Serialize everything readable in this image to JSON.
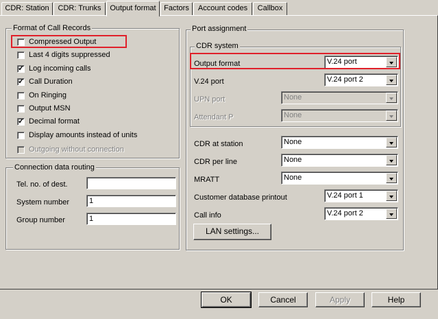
{
  "tabs": [
    {
      "label": "CDR: Station",
      "active": false
    },
    {
      "label": "CDR: Trunks",
      "active": false
    },
    {
      "label": "Output format",
      "active": true
    },
    {
      "label": "Factors",
      "active": false
    },
    {
      "label": "Account codes",
      "active": false
    },
    {
      "label": "Callbox",
      "active": false
    }
  ],
  "format_group": {
    "title": "Format of Call Records",
    "items": [
      {
        "label": "Compressed Output",
        "checked": false,
        "enabled": true
      },
      {
        "label": "Last 4 digits suppressed",
        "checked": false,
        "enabled": true
      },
      {
        "label": "Log incoming calls",
        "checked": true,
        "enabled": true
      },
      {
        "label": "Call Duration",
        "checked": true,
        "enabled": true
      },
      {
        "label": "On Ringing",
        "checked": false,
        "enabled": true
      },
      {
        "label": "Output MSN",
        "checked": false,
        "enabled": true
      },
      {
        "label": "Decimal format",
        "checked": true,
        "enabled": true
      },
      {
        "label": "Display amounts instead of units",
        "checked": false,
        "enabled": true
      },
      {
        "label": "Outgoing without connection",
        "checked": false,
        "enabled": false
      }
    ]
  },
  "routing_group": {
    "title": "Connection data routing",
    "tel_label": "Tel. no. of dest.",
    "tel_value": "",
    "system_label": "System number",
    "system_value": "1",
    "group_label": "Group number",
    "group_value": "1"
  },
  "port_group": {
    "title": "Port assignment",
    "cdr_system_title": "CDR system",
    "output_format_label": "Output format",
    "output_format_value": "V.24 port",
    "v24_port_label": "V.24 port",
    "v24_port_value": "V.24 port 2",
    "upn_port_label": "UPN port",
    "upn_port_value": "None",
    "attendant_label": "Attendant P",
    "attendant_value": "None",
    "cdr_station_label": "CDR at station",
    "cdr_station_value": "None",
    "cdr_line_label": "CDR per line",
    "cdr_line_value": "None",
    "mratt_label": "MRATT",
    "mratt_value": "None",
    "customer_db_label": "Customer database printout",
    "customer_db_value": "V.24 port 1",
    "call_info_label": "Call info",
    "call_info_value": "V.24 port 2",
    "lan_button": "LAN settings..."
  },
  "footer": {
    "ok": "OK",
    "cancel": "Cancel",
    "apply": "Apply",
    "help": "Help"
  },
  "colors": {
    "highlight": "#e0202a",
    "face": "#d4d0c8"
  }
}
